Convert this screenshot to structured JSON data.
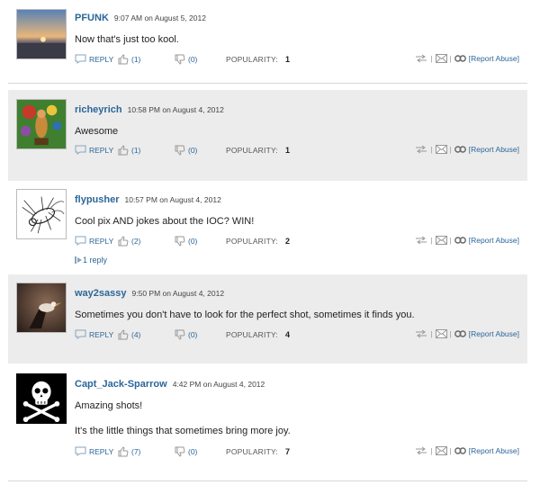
{
  "comments": [
    {
      "user": "PFUNK",
      "time": "9:07 AM on August 5, 2012",
      "text": "Now that's just too kool.",
      "text2": "",
      "likes": "(1)",
      "dislikes": "(0)",
      "popularity": "1",
      "replies": ""
    },
    {
      "user": "richeyrich",
      "time": "10:58 PM on August 4, 2012",
      "text": "Awesome",
      "text2": "",
      "likes": "(1)",
      "dislikes": "(0)",
      "popularity": "1",
      "replies": ""
    },
    {
      "user": "flypusher",
      "time": "10:57 PM on August 4, 2012",
      "text": "Cool pix AND jokes about the IOC? WIN!",
      "text2": "",
      "likes": "(2)",
      "dislikes": "(0)",
      "popularity": "2",
      "replies": "1 reply"
    },
    {
      "user": "way2sassy",
      "time": "9:50 PM on August 4, 2012",
      "text": "Sometimes you don't have to look for the perfect shot, sometimes it finds you.",
      "text2": "",
      "likes": "(4)",
      "dislikes": "(0)",
      "popularity": "4",
      "replies": ""
    },
    {
      "user": "Capt_Jack-Sparrow",
      "time": "4:42 PM on August 4, 2012",
      "text": "Amazing shots!",
      "text2": "It's the little things that sometimes bring more joy.",
      "likes": "(7)",
      "dislikes": "(0)",
      "popularity": "7",
      "replies": ""
    }
  ],
  "labels": {
    "reply": "REPLY",
    "popularity": "POPULARITY:",
    "report": "[Report Abuse]",
    "sep": "|"
  },
  "icons": [
    "reply-icon",
    "thumbs-up-icon",
    "thumbs-down-icon",
    "share-icon",
    "email-icon",
    "link-icon",
    "reply-arrow-icon"
  ],
  "colors": {
    "link": "#2b6699",
    "alt_background": "#ececec"
  }
}
